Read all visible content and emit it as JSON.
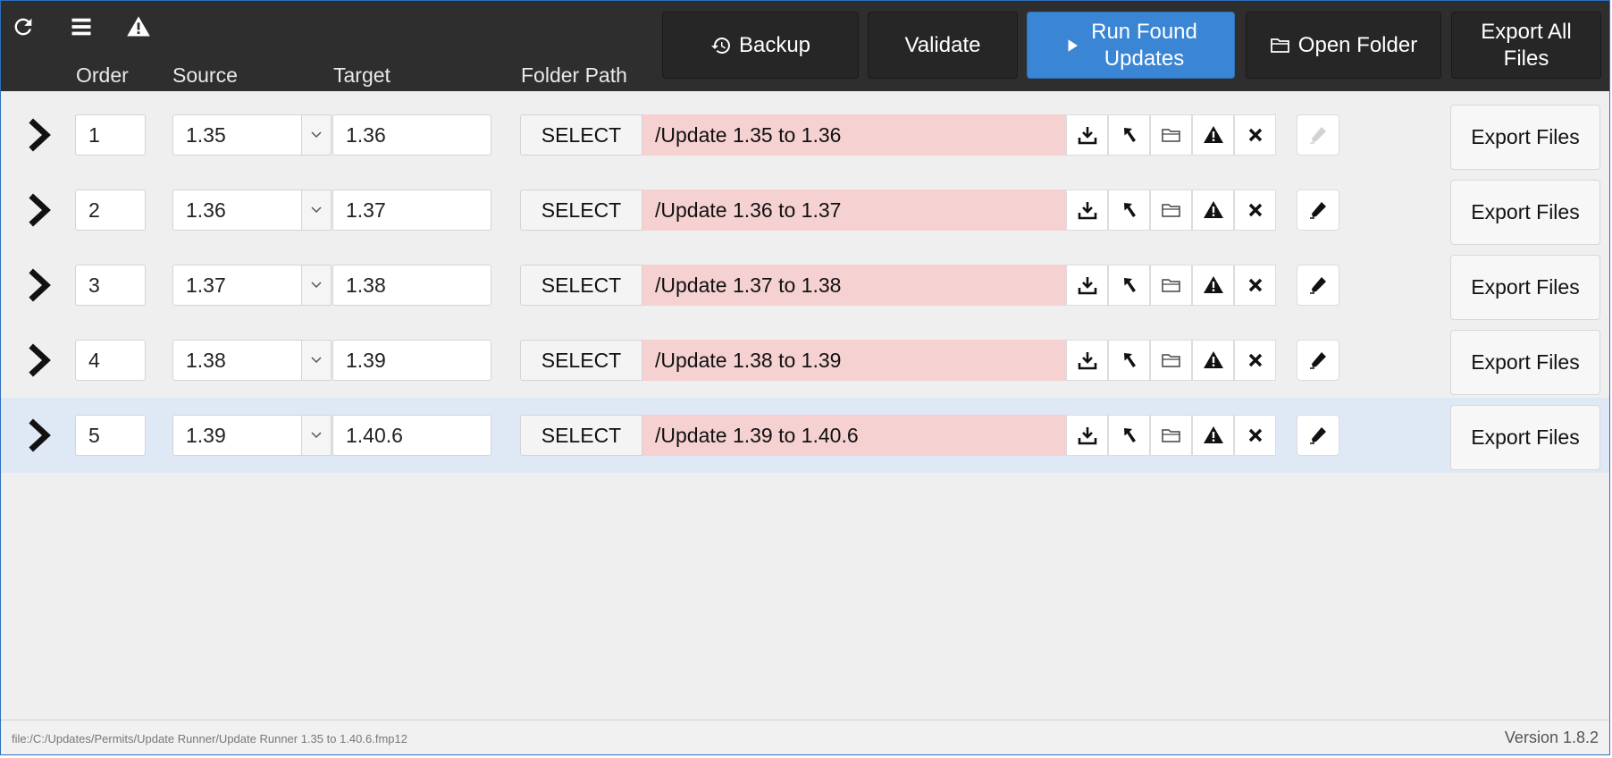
{
  "toolbar": {
    "icons": [
      "refresh-icon",
      "menu-icon",
      "warning-icon"
    ],
    "backup_label": "Backup",
    "validate_label": "Validate",
    "run_label": "Run Found\nUpdates",
    "open_folder_label": "Open Folder",
    "export_all_label": "Export All\nFiles",
    "accent_color": "#3a86d4"
  },
  "columns": {
    "order": "Order",
    "source": "Source",
    "target": "Target",
    "folder_path": "Folder Path"
  },
  "rows": [
    {
      "order": "1",
      "source": "1.35",
      "target": "1.36",
      "select_label": "SELECT",
      "path": "/Update 1.35 to 1.36",
      "export_label": "Export Files",
      "edit_enabled": false,
      "selected": false
    },
    {
      "order": "2",
      "source": "1.36",
      "target": "1.37",
      "select_label": "SELECT",
      "path": "/Update 1.36 to 1.37",
      "export_label": "Export Files",
      "edit_enabled": true,
      "selected": false
    },
    {
      "order": "3",
      "source": "1.37",
      "target": "1.38",
      "select_label": "SELECT",
      "path": "/Update 1.37 to 1.38",
      "export_label": "Export Files",
      "edit_enabled": true,
      "selected": false
    },
    {
      "order": "4",
      "source": "1.38",
      "target": "1.39",
      "select_label": "SELECT",
      "path": "/Update 1.38 to 1.39",
      "export_label": "Export Files",
      "edit_enabled": true,
      "selected": false
    },
    {
      "order": "5",
      "source": "1.39",
      "target": "1.40.6",
      "select_label": "SELECT",
      "path": "/Update 1.39 to 1.40.6",
      "export_label": "Export Files",
      "edit_enabled": true,
      "selected": true
    }
  ],
  "row_icons": [
    "download-icon",
    "up-left-arrow-icon",
    "folder-icon",
    "warning-icon",
    "close-icon",
    "pencil-icon"
  ],
  "colors": {
    "path_bg": "#f6d1d1",
    "selected_row_bg": "#dfe8f5",
    "header_bg": "#2e2e2e"
  },
  "footer": {
    "file_path": "file:/C:/Updates/Permits/Update Runner/Update Runner 1.35 to 1.40.6.fmp12",
    "version": "Version 1.8.2"
  }
}
